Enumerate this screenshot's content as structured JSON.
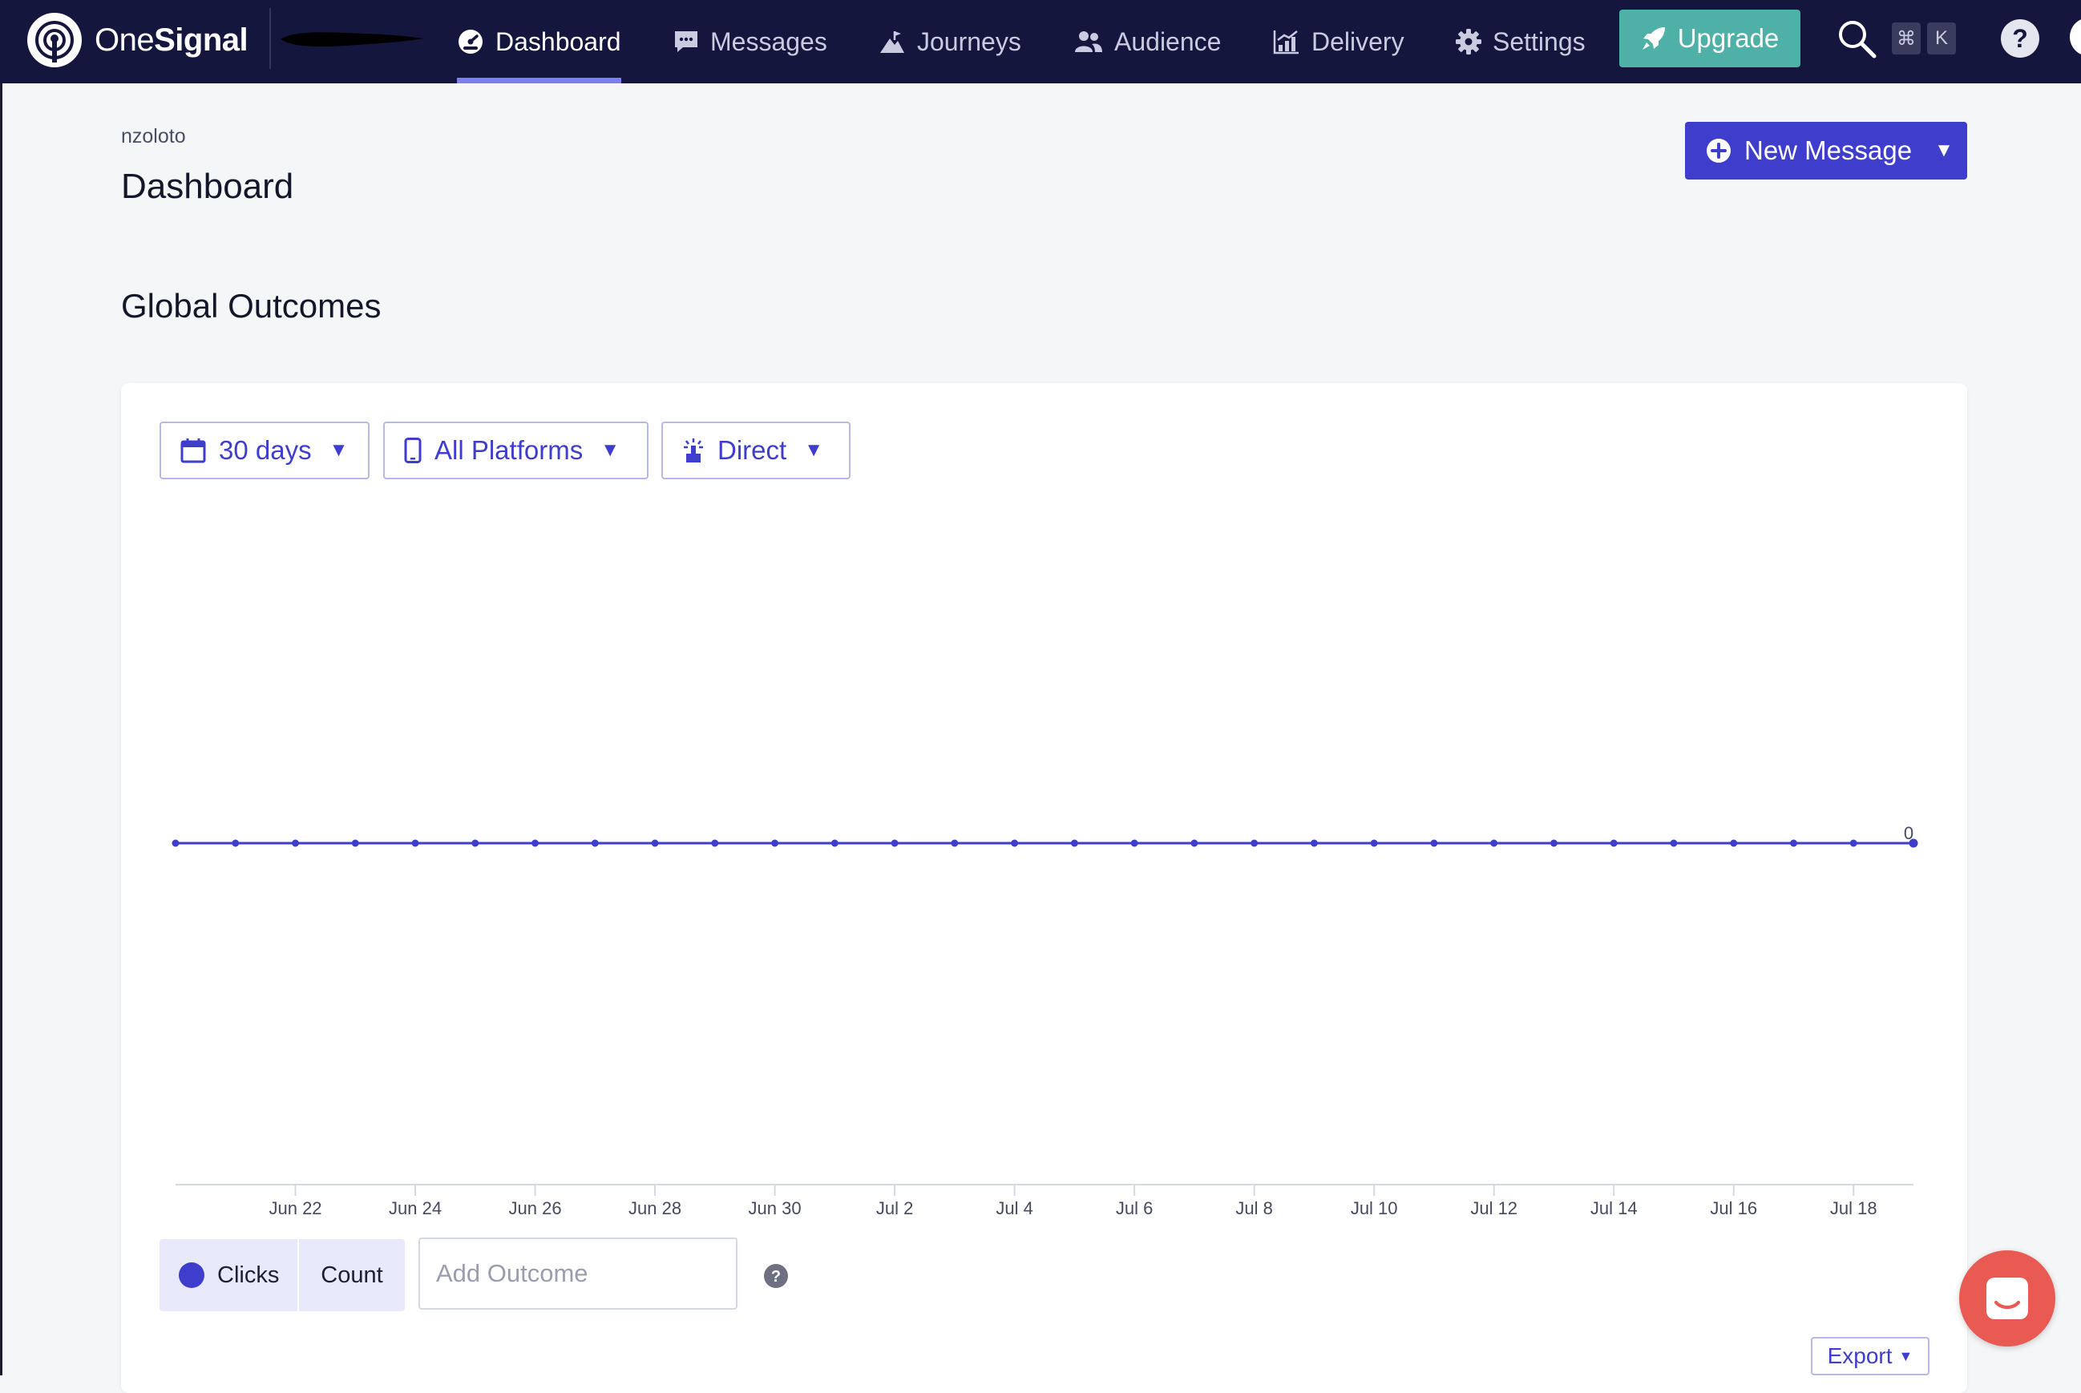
{
  "brand": {
    "name_light": "One",
    "name_bold": "Signal"
  },
  "nav": {
    "items": [
      {
        "label": "Dashboard",
        "icon": "dashboard-gauge-icon",
        "active": true
      },
      {
        "label": "Messages",
        "icon": "message-bubble-icon",
        "active": false
      },
      {
        "label": "Journeys",
        "icon": "mountain-flag-icon",
        "active": false
      },
      {
        "label": "Audience",
        "icon": "users-icon",
        "active": false
      },
      {
        "label": "Delivery",
        "icon": "bar-chart-icon",
        "active": false
      },
      {
        "label": "Settings",
        "icon": "gear-icon",
        "active": false
      }
    ],
    "upgrade_label": "Upgrade",
    "shortcut_keys": [
      "⌘",
      "K"
    ]
  },
  "header": {
    "org_name": "nzoloto",
    "page_title": "Dashboard",
    "new_message_label": "New Message"
  },
  "section": {
    "title": "Global Outcomes"
  },
  "filters": {
    "range": "30 days",
    "platform": "All Platforms",
    "attribution": "Direct"
  },
  "chart_data": {
    "type": "line",
    "x_tick_labels": [
      "Jun 22",
      "Jun 24",
      "Jun 26",
      "Jun 28",
      "Jun 30",
      "Jul 2",
      "Jul 4",
      "Jul 6",
      "Jul 8",
      "Jul 10",
      "Jul 12",
      "Jul 14",
      "Jul 16",
      "Jul 18"
    ],
    "x_start": "Jun 20",
    "x_end": "Jul 19",
    "series": [
      {
        "name": "Clicks",
        "values": [
          0,
          0,
          0,
          0,
          0,
          0,
          0,
          0,
          0,
          0,
          0,
          0,
          0,
          0,
          0,
          0,
          0,
          0,
          0,
          0,
          0,
          0,
          0,
          0,
          0,
          0,
          0,
          0,
          0,
          0
        ]
      }
    ],
    "last_value_label": "0",
    "series_color": "#3e3dcc",
    "grid": false
  },
  "legend": {
    "series_label": "Clicks",
    "metric_label": "Count"
  },
  "outcome_input": {
    "placeholder": "Add Outcome",
    "value": ""
  },
  "export_label": "Export",
  "colors": {
    "topbar": "#15163d",
    "accent": "#3e3dcc",
    "upgrade": "#4fb0a7",
    "chat": "#e85a52"
  }
}
